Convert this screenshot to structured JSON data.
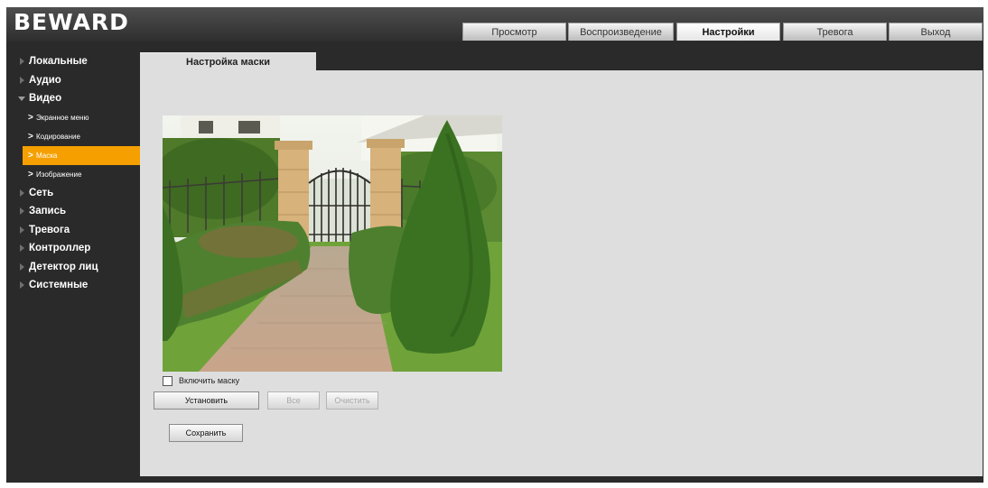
{
  "header": {
    "logo": "BEWARD",
    "tabs": [
      {
        "label": "Просмотр"
      },
      {
        "label": "Воспроизведение"
      },
      {
        "label": "Настройки",
        "active": true
      },
      {
        "label": "Тревога"
      },
      {
        "label": "Выход"
      }
    ]
  },
  "sidebar": {
    "items": [
      {
        "label": "Локальные"
      },
      {
        "label": "Аудио"
      },
      {
        "label": "Видео",
        "expanded": true,
        "children": [
          {
            "label": "Экранное меню"
          },
          {
            "label": "Кодирование"
          },
          {
            "label": "Маска",
            "active": true
          },
          {
            "label": "Изображение"
          }
        ]
      },
      {
        "label": "Сеть"
      },
      {
        "label": "Запись"
      },
      {
        "label": "Тревога"
      },
      {
        "label": "Контроллер"
      },
      {
        "label": "Детектор лиц"
      },
      {
        "label": "Системные"
      }
    ]
  },
  "content": {
    "tab_label": "Настройка маски",
    "enable_mask_label": "Включить маску",
    "enable_mask_checked": false,
    "buttons": {
      "set": "Установить",
      "all": "Все",
      "clear": "Очистить",
      "save": "Сохранить"
    }
  },
  "colors": {
    "active_menu": "#f5a000",
    "panel_bg": "#dedede",
    "frame_bg": "#2a2a2a"
  }
}
